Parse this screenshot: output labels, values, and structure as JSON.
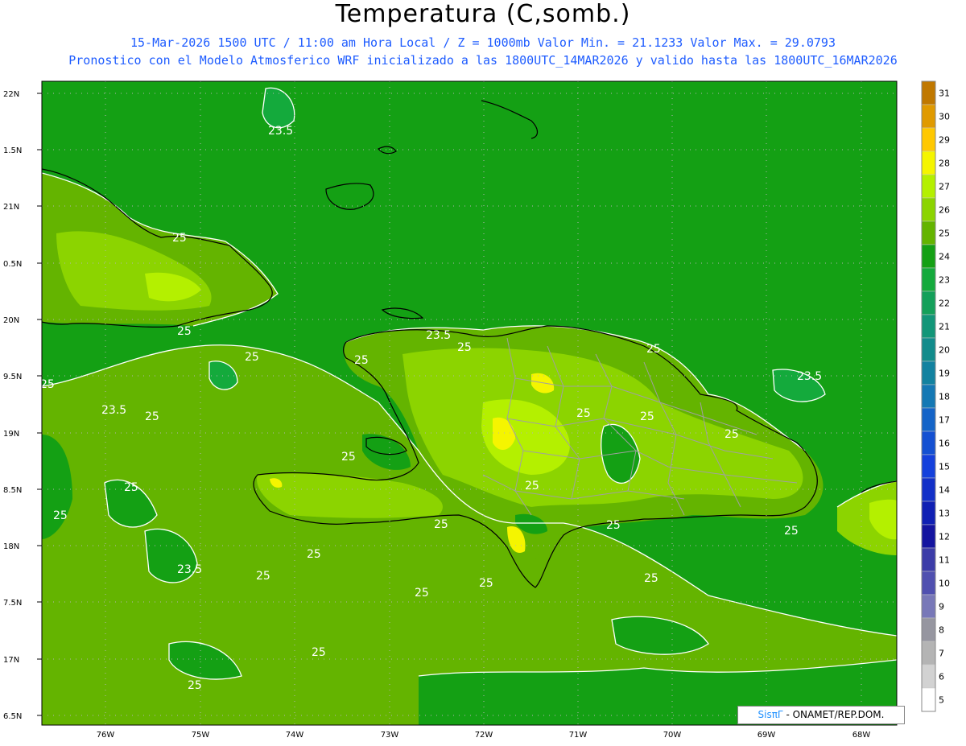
{
  "header": {
    "title": "Temperatura (C,somb.)",
    "line1": "15-Mar-2026 1500 UTC / 11:00 am Hora Local / Z = 1000mb  Valor Min. = 21.1233  Valor Max. = 29.0793",
    "line2": "Pronostico con el Modelo Atmosferico WRF inicializado a las 1800UTC_14MAR2026 y valido hasta las  1800UTC_16MAR2026"
  },
  "axes": {
    "lat_labels": [
      "22N",
      "1.5N",
      "21N",
      "0.5N",
      "20N",
      "9.5N",
      "19N",
      "8.5N",
      "18N",
      "7.5N",
      "17N",
      "6.5N"
    ],
    "lon_labels": [
      "76W",
      "75W",
      "74W",
      "73W",
      "72W",
      "71W",
      "70W",
      "69W",
      "68W"
    ]
  },
  "colorbar": {
    "levels": [
      31,
      30,
      29,
      28,
      27,
      26,
      25,
      24,
      23,
      22,
      21,
      20,
      19,
      18,
      17,
      16,
      15,
      14,
      13,
      12,
      11,
      10,
      9,
      8,
      7,
      6,
      5
    ],
    "colors": [
      "#c07800",
      "#e09a00",
      "#ffc800",
      "#f5f500",
      "#b4f000",
      "#8cd400",
      "#64b400",
      "#14a014",
      "#14aa3c",
      "#14a05a",
      "#129678",
      "#128c8c",
      "#1282a0",
      "#1478b4",
      "#1464c8",
      "#1450d2",
      "#1440dc",
      "#1230c8",
      "#1020b4",
      "#1414a0",
      "#3c3ca8",
      "#5050b0",
      "#7878b8",
      "#9696a0",
      "#b4b4b4",
      "#d2d2d2",
      "#ffffff"
    ]
  },
  "contour_labels": [
    {
      "text": "23.5"
    },
    {
      "text": "25"
    },
    {
      "text": "23.5"
    },
    {
      "text": "25"
    },
    {
      "text": "25"
    },
    {
      "text": "25"
    },
    {
      "text": "25"
    },
    {
      "text": "23.5"
    },
    {
      "text": "25"
    },
    {
      "text": "25"
    },
    {
      "text": "25"
    },
    {
      "text": "25"
    },
    {
      "text": "25"
    },
    {
      "text": "25"
    },
    {
      "text": "23.5"
    },
    {
      "text": "25"
    },
    {
      "text": "25"
    },
    {
      "text": "25"
    },
    {
      "text": "25"
    },
    {
      "text": "25"
    },
    {
      "text": "25"
    },
    {
      "text": "25"
    },
    {
      "text": "23.5"
    },
    {
      "text": "25"
    },
    {
      "text": "25"
    },
    {
      "text": "25"
    },
    {
      "text": "25"
    },
    {
      "text": "25"
    },
    {
      "text": "25"
    },
    {
      "text": "25"
    }
  ],
  "credit": {
    "brand": "SisπΓ",
    "text": " - ONAMET/REP.DOM."
  }
}
